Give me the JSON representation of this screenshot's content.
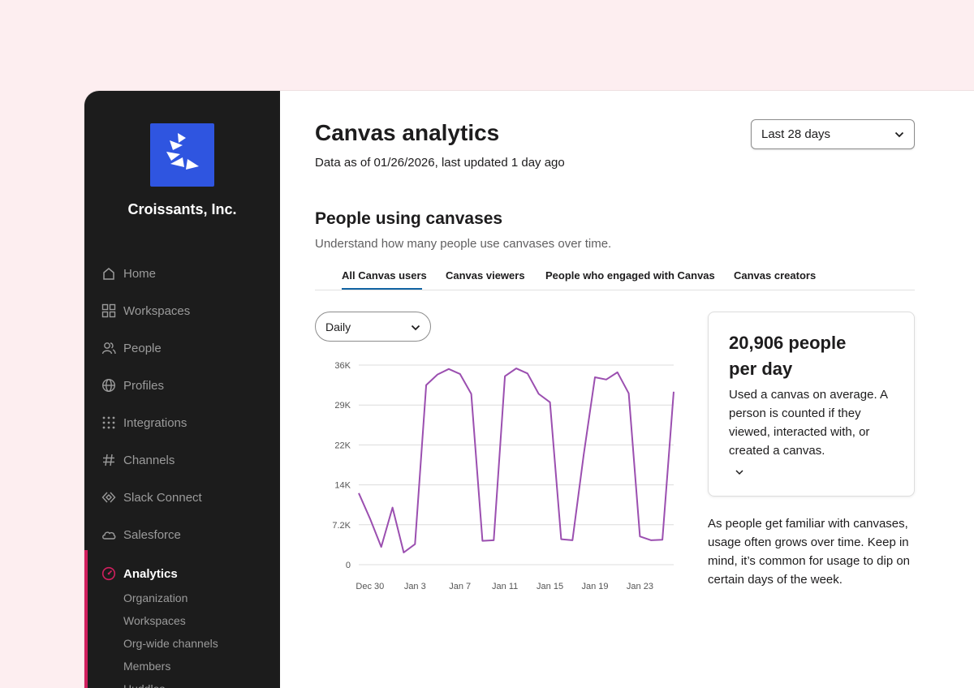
{
  "sidebar": {
    "org_name": "Croissants, Inc.",
    "nav": [
      {
        "label": "Home",
        "icon": "home-icon"
      },
      {
        "label": "Workspaces",
        "icon": "grid-icon"
      },
      {
        "label": "People",
        "icon": "people-icon"
      },
      {
        "label": "Profiles",
        "icon": "globe-icon"
      },
      {
        "label": "Integrations",
        "icon": "dots-grid-icon"
      },
      {
        "label": "Channels",
        "icon": "hash-icon"
      },
      {
        "label": "Slack Connect",
        "icon": "connect-icon"
      },
      {
        "label": "Salesforce",
        "icon": "cloud-icon"
      },
      {
        "label": "Analytics",
        "icon": "gauge-icon"
      }
    ],
    "analytics_sub": [
      "Organization",
      "Workspaces",
      "Org-wide channels",
      "Members",
      "Huddles"
    ],
    "accent_color": "#d11f5e"
  },
  "header": {
    "title": "Canvas analytics",
    "subtitle": "Data as of 01/26/2026, last updated 1 day ago",
    "range_select": "Last 28 days"
  },
  "section": {
    "title": "People using canvases",
    "subtitle": "Understand how many people use canvases over time.",
    "tabs": [
      "All Canvas users",
      "Canvas viewers",
      "People who engaged with Canvas",
      "Canvas creators"
    ],
    "period_select": "Daily"
  },
  "stat": {
    "value": "20,906 people per day",
    "description": "Used a canvas on average. A person is counted if they viewed, interacted with, or created a canvas."
  },
  "note": "As people get familiar with canvases, usage often grows over time. Keep in mind, it’s common for usage to dip on certain days of the week.",
  "chart_data": {
    "type": "line",
    "series_color": "#9b4fb0",
    "y_ticks": [
      "36K",
      "29K",
      "22K",
      "14K",
      "7.2K",
      "0"
    ],
    "x_ticks": [
      "Dec 30",
      "Jan 3",
      "Jan 7",
      "Jan 11",
      "Jan 15",
      "Jan 19",
      "Jan 23"
    ],
    "ylim": [
      0,
      36000
    ],
    "x": [
      "Dec 29",
      "Dec 30",
      "Dec 31",
      "Jan 1",
      "Jan 2",
      "Jan 3",
      "Jan 4",
      "Jan 5",
      "Jan 6",
      "Jan 7",
      "Jan 8",
      "Jan 9",
      "Jan 10",
      "Jan 11",
      "Jan 12",
      "Jan 13",
      "Jan 14",
      "Jan 15",
      "Jan 16",
      "Jan 17",
      "Jan 18",
      "Jan 19",
      "Jan 20",
      "Jan 21",
      "Jan 22",
      "Jan 23",
      "Jan 24",
      "Jan 25",
      "Jan 26"
    ],
    "values": [
      12900,
      8300,
      3200,
      10300,
      2200,
      3700,
      32400,
      34300,
      35300,
      34400,
      30800,
      4300,
      4400,
      34000,
      35400,
      34500,
      30800,
      29300,
      4600,
      4400,
      19800,
      33800,
      33400,
      34700,
      30900,
      5100,
      4400,
      4500,
      31200
    ],
    "grid": true
  }
}
